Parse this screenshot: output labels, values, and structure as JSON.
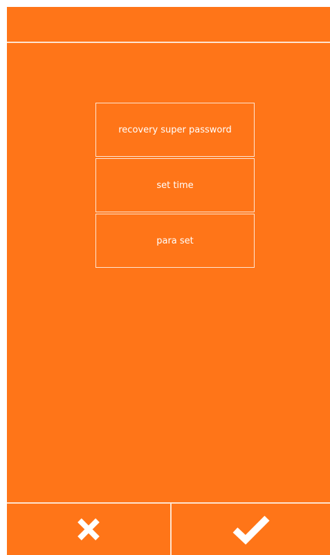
{
  "menu": {
    "items": [
      {
        "label": "recovery super password"
      },
      {
        "label": "set time"
      },
      {
        "label": "para set"
      }
    ]
  },
  "bottom_bar": {
    "cancel_icon": "close-icon",
    "confirm_icon": "checkmark-icon"
  },
  "colors": {
    "background": "#ff7518",
    "lines": "#ffe4cf",
    "text": "#ffffff"
  }
}
